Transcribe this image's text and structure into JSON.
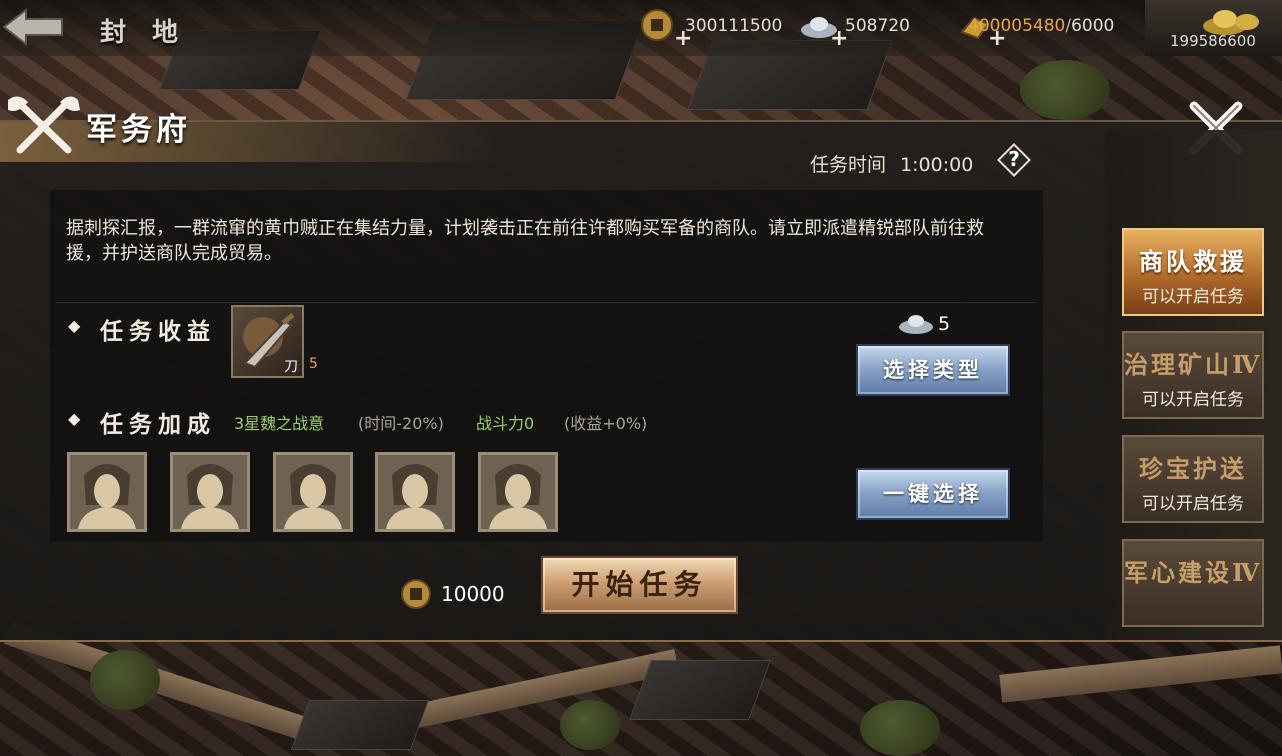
{
  "topbar": {
    "title": "封地",
    "copper": "300111500",
    "silver": "508720",
    "food_current": "400005480",
    "food_separator": "/",
    "food_max": "6000",
    "gold": "199586600",
    "plus": "+"
  },
  "panel": {
    "title": "军务府",
    "task_time_label": "任务时间",
    "task_time_value": "1:00:00",
    "help": "?",
    "description": "据刺探汇报，一群流窜的黄巾贼正在集结力量，计划袭击正在前往许都购买军备的商队。请立即派遣精锐部队前往救援，并护送商队完成贸易。",
    "reward_label": "任务收益",
    "reward_item_name": "刀",
    "reward_item_count": "5",
    "silver_cost": "5",
    "select_type_label": "选择类型",
    "bonus_label": "任务加成",
    "bonus_hero": "3星魏之战意",
    "bonus_time": "(时间-20%)",
    "bonus_power": "战斗力0",
    "bonus_income": "(收益+0%)",
    "one_key_label": "一键选择",
    "coin_cost": "10000",
    "start_label": "开始任务"
  },
  "tabs": [
    {
      "title": "商队救援",
      "sub": "可以开启任务",
      "active": true
    },
    {
      "title": "治理矿山Ⅳ",
      "sub": "可以开启任务",
      "active": false
    },
    {
      "title": "珍宝护送",
      "sub": "可以开启任务",
      "active": false
    },
    {
      "title": "军心建设Ⅳ",
      "sub": "",
      "active": false
    }
  ],
  "colors": {
    "gold_text": "#e8a840",
    "green_text": "#9ad06a",
    "grey_text": "#a8a29a",
    "tab_active": "#c07a30"
  },
  "icons": [
    "back-arrow-icon",
    "copper-coin-icon",
    "silver-ingot-icon",
    "food-icon",
    "gold-ingot-icon",
    "crossed-axe-emblem-icon",
    "close-icon",
    "help-icon",
    "blade-icon",
    "hero-silhouette-icon"
  ]
}
